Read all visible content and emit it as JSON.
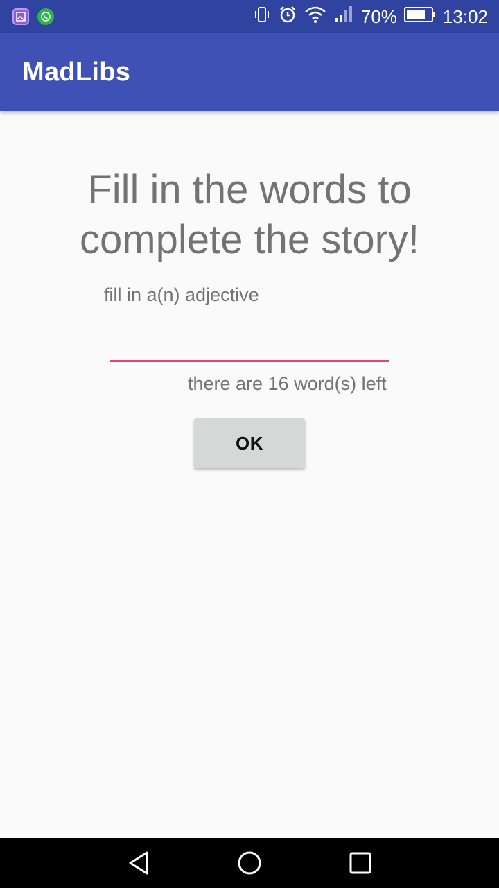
{
  "status_bar": {
    "battery": "70%",
    "time": "13:02",
    "icons": [
      "gallery-icon",
      "whatsapp-icon",
      "vibrate-icon",
      "alarm-icon",
      "wifi-icon",
      "signal-icon",
      "battery-icon"
    ]
  },
  "app_bar": {
    "title": "MadLibs"
  },
  "main": {
    "heading": "Fill in the words to complete the story!",
    "prompt": "fill in a(n) adjective",
    "input": {
      "value": "",
      "placeholder": ""
    },
    "counter": "there are 16 word(s) left",
    "ok_label": "OK"
  },
  "nav_bar": {
    "icons": [
      "back-icon",
      "home-icon",
      "recents-icon"
    ]
  },
  "colors": {
    "status_bar": "#3043a0",
    "app_bar": "#3f51b5",
    "input_underline": "#e0457b",
    "button": "#d6d7d7"
  }
}
